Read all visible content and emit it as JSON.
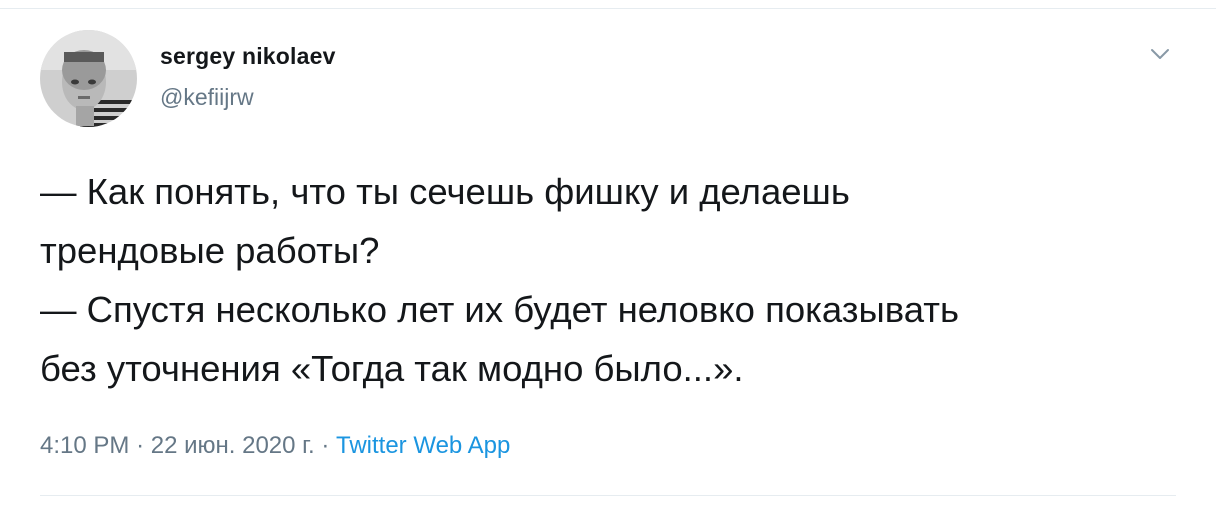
{
  "tweet": {
    "author": {
      "display_name": "sergey nikolaev",
      "handle": "@kefiijrw"
    },
    "text_lines": [
      "— Как понять, что ты сечешь фишку и делаешь",
      "трендовые работы?",
      "— Спустя несколько лет их будет неловко показывать",
      "без уточнения «Тогда так модно было...»."
    ],
    "time": "4:10 PM",
    "separator": "·",
    "date": "22 июн. 2020 г.",
    "source": "Twitter Web App"
  },
  "icons": {
    "menu": "chevron-down-icon",
    "avatar": "user-avatar-photo"
  },
  "colors": {
    "text": "#14171a",
    "secondary": "#657786",
    "link": "#1b95e0",
    "divider": "#e6ecf0"
  }
}
